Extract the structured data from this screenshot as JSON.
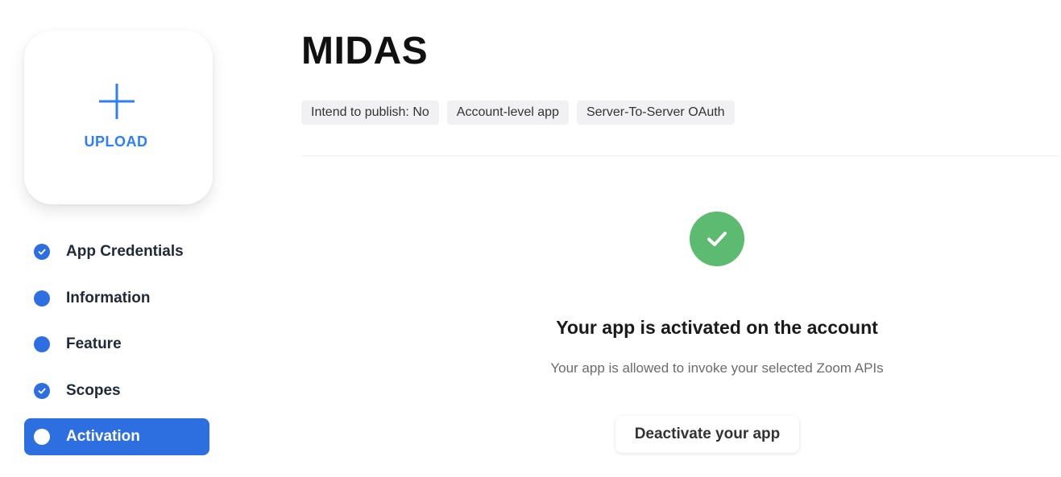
{
  "upload": {
    "label": "UPLOAD",
    "icon": "plus-icon"
  },
  "nav": {
    "items": [
      {
        "label": "App Credentials",
        "state": "completed",
        "icon": "check-icon"
      },
      {
        "label": "Information",
        "state": "incomplete",
        "icon": "dot-icon"
      },
      {
        "label": "Feature",
        "state": "incomplete",
        "icon": "dot-icon"
      },
      {
        "label": "Scopes",
        "state": "completed",
        "icon": "check-icon"
      },
      {
        "label": "Activation",
        "state": "active",
        "icon": "dot-icon"
      }
    ]
  },
  "header": {
    "title": "MIDAS",
    "tags": [
      "Intend to publish: No",
      "Account-level app",
      "Server-To-Server OAuth"
    ]
  },
  "activation": {
    "icon": "check-circle-icon",
    "title": "Your app is activated on the account",
    "subtitle": "Your app is allowed to invoke your selected Zoom APIs",
    "button_label": "Deactivate your app"
  },
  "colors": {
    "accent": "#2d6fe0",
    "upload_blue": "#2d7ff9",
    "success_green": "#5dbb71"
  }
}
